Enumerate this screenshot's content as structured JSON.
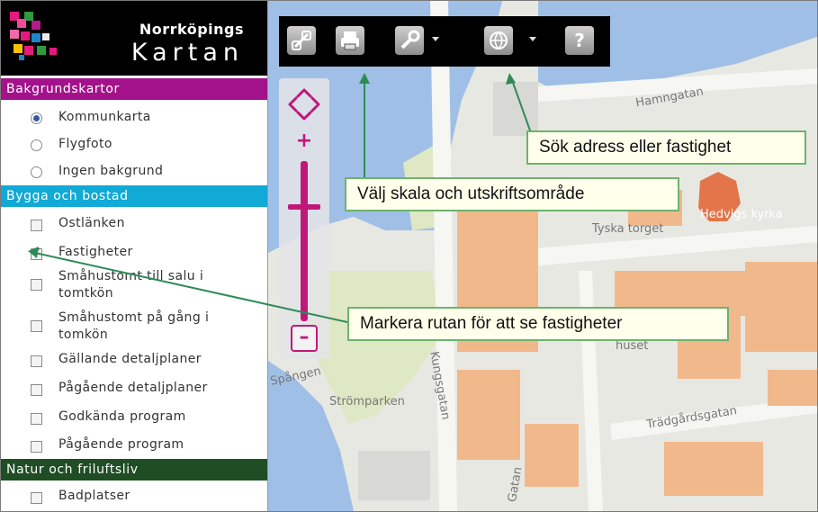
{
  "app": {
    "title_line1": "Norrköpings",
    "title_line2": "Kartan"
  },
  "sidebar": {
    "sections": [
      {
        "label": "Bakgrundskartor",
        "color": "#a3128a",
        "items": [
          {
            "label": "Kommunkarta",
            "control": "radio",
            "checked": true
          },
          {
            "label": "Flygfoto",
            "control": "radio",
            "checked": false
          },
          {
            "label": "Ingen bakgrund",
            "control": "radio",
            "checked": false
          }
        ]
      },
      {
        "label": "Bygga och bostad",
        "color": "#11a9d6",
        "items": [
          {
            "label": "Ostlänken",
            "control": "checkbox",
            "checked": false
          },
          {
            "label": "Fastigheter",
            "control": "checkbox",
            "checked": true
          },
          {
            "label": "Småhustomt till salu i tomtkön",
            "control": "checkbox",
            "checked": false
          },
          {
            "label": "Småhustomt på gång i tomkön",
            "control": "checkbox",
            "checked": false
          },
          {
            "label": "Gällande detaljplaner",
            "control": "checkbox",
            "checked": false
          },
          {
            "label": "Pågående detaljplaner",
            "control": "checkbox",
            "checked": false
          },
          {
            "label": "Godkända program",
            "control": "checkbox",
            "checked": false
          },
          {
            "label": "Pågående program",
            "control": "checkbox",
            "checked": false
          }
        ]
      },
      {
        "label": "Natur och friluftsliv",
        "color": "#1f4d24",
        "items": [
          {
            "label": "Badplatser",
            "control": "checkbox",
            "checked": false
          }
        ]
      }
    ]
  },
  "toolbar": {
    "buttons": [
      {
        "icon": "link-icon",
        "name": "link-button"
      },
      {
        "icon": "print-icon",
        "name": "print-button"
      },
      {
        "icon": "wrench-icon",
        "name": "tools-button",
        "dropdown": true
      },
      {
        "icon": "globe-icon",
        "name": "search-button",
        "dropdown": true
      },
      {
        "icon": "help-icon",
        "name": "help-button",
        "glyph": "?"
      }
    ]
  },
  "zoom": {
    "plus": "+",
    "minus": "–",
    "level": 0.73
  },
  "callouts": {
    "search": "Sök adress eller fastighet",
    "scale": "Välj skala och utskriftsområde",
    "mark": "Markera rutan för att se fastigheter"
  },
  "map_labels": {
    "hamngatan": "Hamngatan",
    "hedvigs": "Hedvigs kyrka",
    "tyska_torget": "Tyska torget",
    "spangen": "Spången",
    "stromparken": "Strömparken",
    "tradgardsgatan": "Trädgårdsgatan",
    "huset": "huset",
    "gatan": "Gatan",
    "kungsgatan": "Kungsgatan"
  },
  "colors": {
    "accent": "#c0187a",
    "water": "#9fbfe6",
    "park": "#dfe8c4",
    "building": "#f1b88c",
    "church": "#e2754a",
    "callout_border": "#6db36d"
  }
}
